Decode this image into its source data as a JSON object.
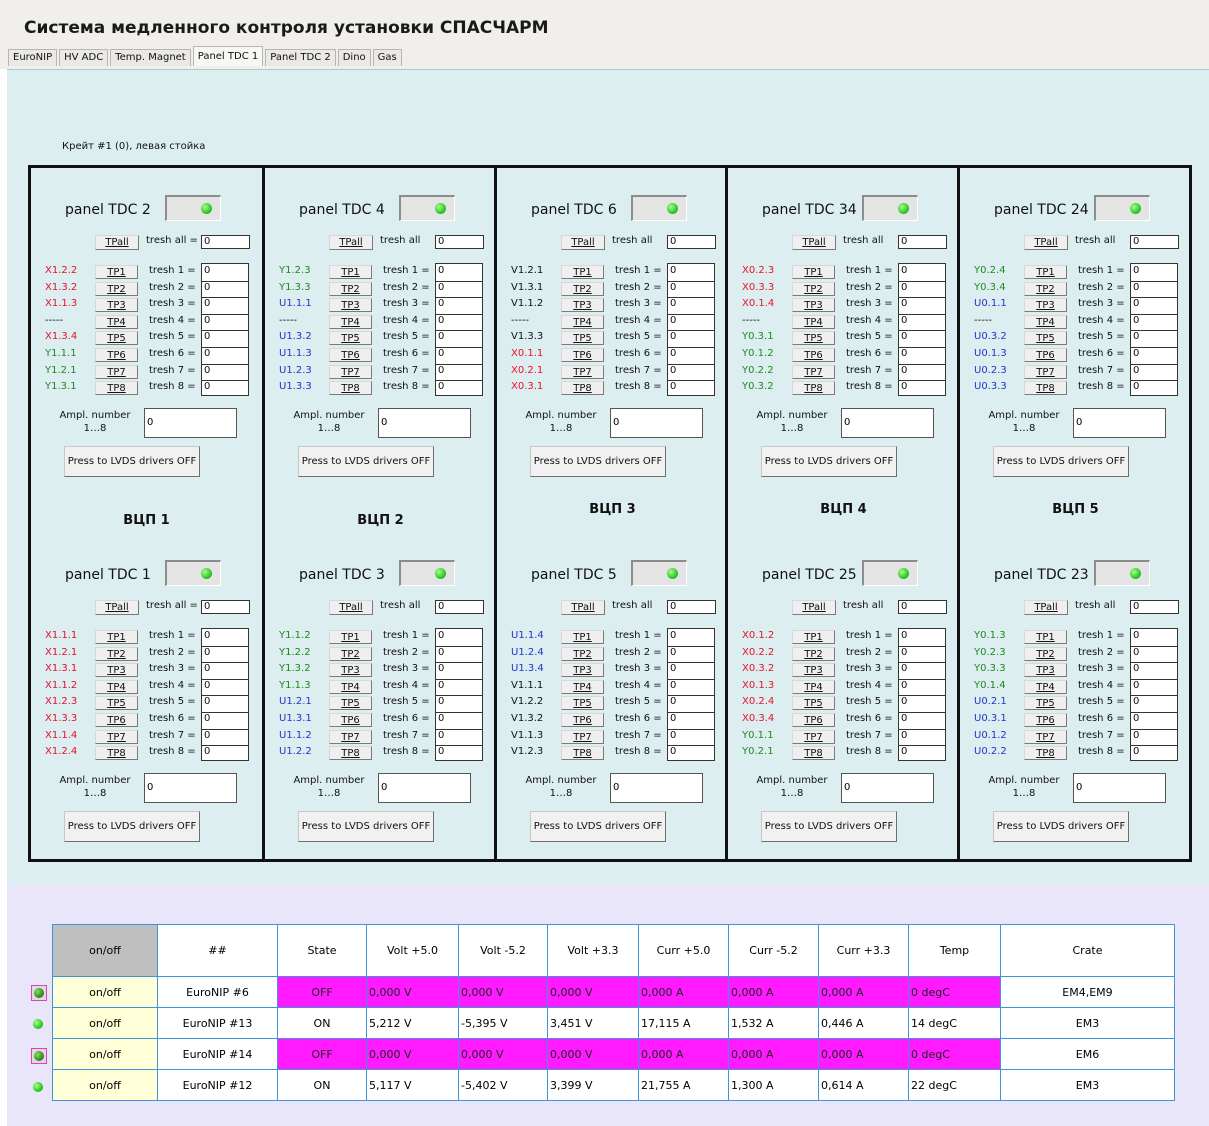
{
  "app_title": "Система медленного контроля установки СПАСЧАРМ",
  "tabs": [
    "EuroNIP",
    "HV ADC",
    "Temp. Magnet",
    "Panel TDC 1",
    "Panel TDC 2",
    "Dino",
    "Gas"
  ],
  "active_tab": "Panel TDC 1",
  "crate_label": "Крейт #1 (0), левая стойка",
  "common": {
    "tp_all": "TPall",
    "tp_labels": [
      "TP1",
      "TP2",
      "TP3",
      "TP4",
      "TP5",
      "TP6",
      "TP7",
      "TP8"
    ],
    "ampl_label_1": "Ampl. number",
    "ampl_label_2": "1…8",
    "lvds_button": "Press to LVDS drivers OFF"
  },
  "columns": [
    {
      "vcp": "ВЦП 1",
      "panels": [
        {
          "title": "panel TDC 2",
          "tresh_all_label": "tresh all =",
          "tresh_all_value": "0",
          "tresh_labels": [
            "tresh 1 =",
            "tresh 2 =",
            "tresh 3 =",
            "tresh 4 =",
            "tresh 5 =",
            "tresh 6 =",
            "tresh 7 =",
            "tresh 8 ="
          ],
          "tresh_values": [
            "0",
            "0",
            "0",
            "0",
            "0",
            "0",
            "0",
            "0"
          ],
          "channels": [
            {
              "n": "X1.2.2",
              "c": "red"
            },
            {
              "n": "X1.3.2",
              "c": "red"
            },
            {
              "n": "X1.1.3",
              "c": "red"
            },
            {
              "n": "-----",
              "c": "black"
            },
            {
              "n": "X1.3.4",
              "c": "red"
            },
            {
              "n": "Y1.1.1",
              "c": "green"
            },
            {
              "n": "Y1.2.1",
              "c": "green"
            },
            {
              "n": "Y1.3.1",
              "c": "green"
            }
          ],
          "ampl_value": "0"
        },
        {
          "title": "panel TDC 1",
          "tresh_all_label": "tresh all =",
          "tresh_all_value": "0",
          "tresh_labels": [
            "tresh 1 =",
            "tresh 2 =",
            "tresh 3 =",
            "tresh 4 =",
            "tresh 5 =",
            "tresh 6 =",
            "tresh 7 =",
            "tresh 8 ="
          ],
          "tresh_values": [
            "0",
            "0",
            "0",
            "0",
            "0",
            "0",
            "0",
            "0"
          ],
          "channels": [
            {
              "n": "X1.1.1",
              "c": "red"
            },
            {
              "n": "X1.2.1",
              "c": "red"
            },
            {
              "n": "X1.3.1",
              "c": "red"
            },
            {
              "n": "X1.1.2",
              "c": "red"
            },
            {
              "n": "X1.2.3",
              "c": "red"
            },
            {
              "n": "X1.3.3",
              "c": "red"
            },
            {
              "n": "X1.1.4",
              "c": "red"
            },
            {
              "n": "X1.2.4",
              "c": "red"
            }
          ],
          "ampl_value": "0"
        }
      ]
    },
    {
      "vcp": "ВЦП 2",
      "panels": [
        {
          "title": "panel TDC 4",
          "tresh_all_label": "tresh all",
          "tresh_all_value": "0",
          "tresh_labels": [
            "tresh 1 =",
            "tresh 2 =",
            "tresh 3 =",
            "tresh 4 =",
            "tresh 5 =",
            "tresh 6 =",
            "tresh 7 =",
            "tresh 8 ="
          ],
          "tresh_values": [
            "0",
            "0",
            "0",
            "0",
            "0",
            "0",
            "0",
            "0"
          ],
          "channels": [
            {
              "n": "Y1.2.3",
              "c": "green"
            },
            {
              "n": "Y1.3.3",
              "c": "green"
            },
            {
              "n": "U1.1.1",
              "c": "blue"
            },
            {
              "n": "-----",
              "c": "black"
            },
            {
              "n": "U1.3.2",
              "c": "blue"
            },
            {
              "n": "U1.1.3",
              "c": "blue"
            },
            {
              "n": "U1.2.3",
              "c": "blue"
            },
            {
              "n": "U1.3.3",
              "c": "blue"
            }
          ],
          "ampl_value": "0"
        },
        {
          "title": "panel TDC 3",
          "tresh_all_label": "tresh all",
          "tresh_all_value": "0",
          "tresh_labels": [
            "tresh 1 =",
            "tresh 2 =",
            "tresh 3 =",
            "tresh 4 =",
            "tresh 5 =",
            "tresh 6 =",
            "tresh 7 =",
            "tresh 8 ="
          ],
          "tresh_values": [
            "0",
            "0",
            "0",
            "0",
            "0",
            "0",
            "0",
            "0"
          ],
          "channels": [
            {
              "n": "Y1.1.2",
              "c": "green"
            },
            {
              "n": "Y1.2.2",
              "c": "green"
            },
            {
              "n": "Y1.3.2",
              "c": "green"
            },
            {
              "n": "Y1.1.3",
              "c": "green"
            },
            {
              "n": "U1.2.1",
              "c": "blue"
            },
            {
              "n": "U1.3.1",
              "c": "blue"
            },
            {
              "n": "U1.1.2",
              "c": "blue"
            },
            {
              "n": "U1.2.2",
              "c": "blue"
            }
          ],
          "ampl_value": "0"
        }
      ]
    },
    {
      "vcp": "ВЦП 3",
      "panels": [
        {
          "title": "panel TDC 6",
          "tresh_all_label": "tresh all",
          "tresh_all_value": "0",
          "tresh_labels": [
            "tresh 1 =",
            "tresh 2 =",
            "tresh 3 =",
            "tresh 4 =",
            "tresh 5 =",
            "tresh 6 =",
            "tresh 7 =",
            "tresh 8 ="
          ],
          "tresh_values": [
            "0",
            "0",
            "0",
            "0",
            "0",
            "0",
            "0",
            "0"
          ],
          "channels": [
            {
              "n": "V1.2.1",
              "c": "black"
            },
            {
              "n": "V1.3.1",
              "c": "black"
            },
            {
              "n": "V1.1.2",
              "c": "black"
            },
            {
              "n": "-----",
              "c": "black"
            },
            {
              "n": "V1.3.3",
              "c": "black"
            },
            {
              "n": "X0.1.1",
              "c": "red"
            },
            {
              "n": "X0.2.1",
              "c": "red"
            },
            {
              "n": "X0.3.1",
              "c": "red"
            }
          ],
          "ampl_value": "0"
        },
        {
          "title": "panel TDC 5",
          "tresh_all_label": "tresh all",
          "tresh_all_value": "0",
          "tresh_labels": [
            "tresh 1 =",
            "tresh 2 =",
            "tresh 3 =",
            "tresh 4 =",
            "tresh 5 =",
            "tresh 6 =",
            "tresh 7 =",
            "tresh 8 ="
          ],
          "tresh_values": [
            "0",
            "0",
            "0",
            "0",
            "0",
            "0",
            "0",
            "0"
          ],
          "channels": [
            {
              "n": "U1.1.4",
              "c": "blue"
            },
            {
              "n": "U1.2.4",
              "c": "blue"
            },
            {
              "n": "U1.3.4",
              "c": "blue"
            },
            {
              "n": "V1.1.1",
              "c": "black"
            },
            {
              "n": "V1.2.2",
              "c": "black"
            },
            {
              "n": "V1.3.2",
              "c": "black"
            },
            {
              "n": "V1.1.3",
              "c": "black"
            },
            {
              "n": "V1.2.3",
              "c": "black"
            }
          ],
          "ampl_value": "0"
        }
      ]
    },
    {
      "vcp": "ВЦП 4",
      "panels": [
        {
          "title": "panel TDC 34",
          "tresh_all_label": "tresh all",
          "tresh_all_value": "0",
          "tresh_labels": [
            "tresh 1 =",
            "tresh 2 =",
            "tresh 3 =",
            "tresh 4 =",
            "tresh 5 =",
            "tresh 6 =",
            "tresh 7 =",
            "tresh 8 ="
          ],
          "tresh_values": [
            "0",
            "0",
            "0",
            "0",
            "0",
            "0",
            "0",
            "0"
          ],
          "channels": [
            {
              "n": "X0.2.3",
              "c": "red"
            },
            {
              "n": "X0.3.3",
              "c": "red"
            },
            {
              "n": "X0.1.4",
              "c": "red"
            },
            {
              "n": "-----",
              "c": "black"
            },
            {
              "n": "Y0.3.1",
              "c": "green"
            },
            {
              "n": "Y0.1.2",
              "c": "green"
            },
            {
              "n": "Y0.2.2",
              "c": "green"
            },
            {
              "n": "Y0.3.2",
              "c": "green"
            }
          ],
          "ampl_value": "0"
        },
        {
          "title": "panel TDC 25",
          "tresh_all_label": "tresh all",
          "tresh_all_value": "0",
          "tresh_labels": [
            "tresh 1 =",
            "tresh 2 =",
            "tresh 3 =",
            "tresh 4 =",
            "tresh 5 =",
            "tresh 6 =",
            "tresh 7 =",
            "tresh 8 ="
          ],
          "tresh_values": [
            "0",
            "0",
            "0",
            "0",
            "0",
            "0",
            "0",
            "0"
          ],
          "channels": [
            {
              "n": "X0.1.2",
              "c": "red"
            },
            {
              "n": "X0.2.2",
              "c": "red"
            },
            {
              "n": "X0.3.2",
              "c": "red"
            },
            {
              "n": "X0.1.3",
              "c": "red"
            },
            {
              "n": "X0.2.4",
              "c": "red"
            },
            {
              "n": "X0.3.4",
              "c": "red"
            },
            {
              "n": "Y0.1.1",
              "c": "green"
            },
            {
              "n": "Y0.2.1",
              "c": "green"
            }
          ],
          "ampl_value": "0"
        }
      ]
    },
    {
      "vcp": "ВЦП 5",
      "panels": [
        {
          "title": "panel TDC 24",
          "tresh_all_label": "tresh all",
          "tresh_all_value": "0",
          "tresh_labels": [
            "tresh 1 =",
            "tresh 2 =",
            "tresh 3 =",
            "tresh 4 =",
            "tresh 5 =",
            "tresh 6 =",
            "tresh 7 =",
            "tresh 8 ="
          ],
          "tresh_values": [
            "0",
            "0",
            "0",
            "0",
            "0",
            "0",
            "0",
            "0"
          ],
          "channels": [
            {
              "n": "Y0.2.4",
              "c": "green"
            },
            {
              "n": "Y0.3.4",
              "c": "green"
            },
            {
              "n": "U0.1.1",
              "c": "blue"
            },
            {
              "n": "-----",
              "c": "black"
            },
            {
              "n": "U0.3.2",
              "c": "blue"
            },
            {
              "n": "U0.1.3",
              "c": "blue"
            },
            {
              "n": "U0.2.3",
              "c": "blue"
            },
            {
              "n": "U0.3.3",
              "c": "blue"
            }
          ],
          "ampl_value": "0"
        },
        {
          "title": "panel TDC 23",
          "tresh_all_label": "tresh all",
          "tresh_all_value": "0",
          "tresh_labels": [
            "tresh 1 =",
            "tresh 2 =",
            "tresh 3 =",
            "tresh 4 =",
            "tresh 5 =",
            "tresh 6 =",
            "tresh 7 =",
            "tresh 8 ="
          ],
          "tresh_values": [
            "0",
            "0",
            "0",
            "0",
            "0",
            "0",
            "0",
            "0"
          ],
          "channels": [
            {
              "n": "Y0.1.3",
              "c": "green"
            },
            {
              "n": "Y0.2.3",
              "c": "green"
            },
            {
              "n": "Y0.3.3",
              "c": "green"
            },
            {
              "n": "Y0.1.4",
              "c": "green"
            },
            {
              "n": "U0.2.1",
              "c": "blue"
            },
            {
              "n": "U0.3.1",
              "c": "blue"
            },
            {
              "n": "U0.1.2",
              "c": "blue"
            },
            {
              "n": "U0.2.2",
              "c": "blue"
            }
          ],
          "ampl_value": "0"
        }
      ]
    }
  ],
  "colors": {
    "red": "#e8102a",
    "green": "#1d8a1d",
    "blue": "#2233cc",
    "black": "#111111",
    "off_highlight": "#ff1aff",
    "led_on": "#2ec82e"
  },
  "table": {
    "headers": [
      "on/off",
      "##",
      "State",
      "Volt +5.0",
      "Volt -5.2",
      "Volt +3.3",
      "Curr +5.0",
      "Curr -5.2",
      "Curr +3.3",
      "Temp",
      "Crate"
    ],
    "rows": [
      {
        "onoff": "on/off",
        "name": "EuroNIP #6",
        "state": "OFF",
        "v50": "0,000 V",
        "v52": "0,000 V",
        "v33": "0,000 V",
        "c50": "0,000 A",
        "c52": "0,000 A",
        "c33": "0,000 A",
        "temp": "0 degC",
        "crate": "EM4,EM9",
        "off": true
      },
      {
        "onoff": "on/off",
        "name": "EuroNIP #13",
        "state": "ON",
        "v50": "5,212 V",
        "v52": "-5,395 V",
        "v33": "3,451 V",
        "c50": "17,115 A",
        "c52": "1,532 A",
        "c33": "0,446 A",
        "temp": "14 degC",
        "crate": "EM3",
        "off": false
      },
      {
        "onoff": "on/off",
        "name": "EuroNIP #14",
        "state": "OFF",
        "v50": "0,000 V",
        "v52": "0,000 V",
        "v33": "0,000 V",
        "c50": "0,000 A",
        "c52": "0,000 A",
        "c33": "0,000 A",
        "temp": "0 degC",
        "crate": "EM6",
        "off": true
      },
      {
        "onoff": "on/off",
        "name": "EuroNIP #12",
        "state": "ON",
        "v50": "5,117 V",
        "v52": "-5,402 V",
        "v33": "3,399 V",
        "c50": "21,755 A",
        "c52": "1,300 A",
        "c33": "0,614 A",
        "temp": "22 degC",
        "crate": "EM3",
        "off": false
      }
    ]
  }
}
